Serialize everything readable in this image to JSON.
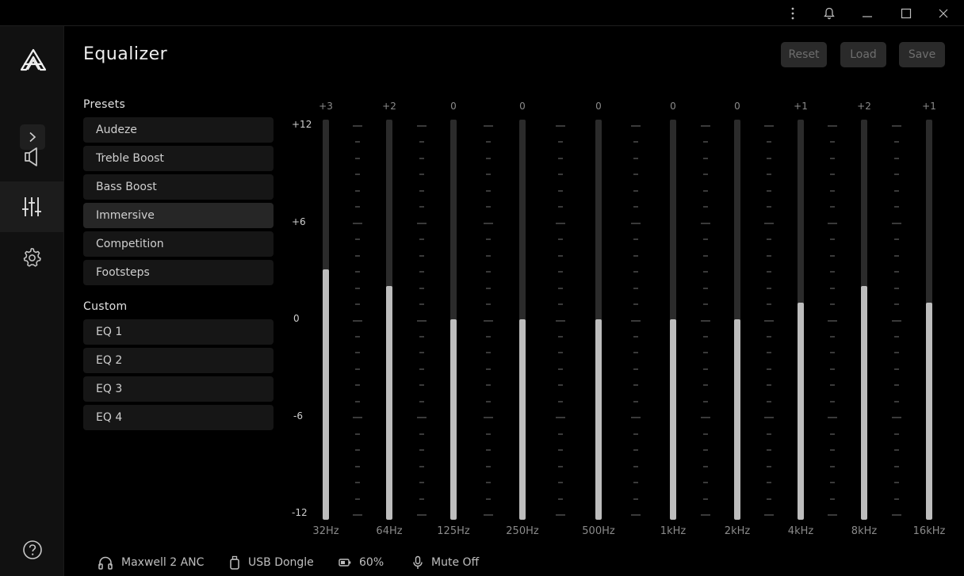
{
  "window": {
    "controls": [
      "more-icon",
      "bell-icon",
      "minimize-icon",
      "maximize-icon",
      "close-icon"
    ]
  },
  "sidebar": {
    "nav": [
      {
        "icon": "speaker-icon",
        "active": false
      },
      {
        "icon": "equalizer-icon",
        "active": true
      },
      {
        "icon": "gear-icon",
        "active": false
      }
    ],
    "help_icon": "help-icon"
  },
  "page": {
    "title": "Equalizer"
  },
  "toolbar": {
    "reset_label": "Reset",
    "load_label": "Load",
    "save_label": "Save"
  },
  "presets": {
    "label": "Presets",
    "items": [
      "Audeze",
      "Treble Boost",
      "Bass Boost",
      "Immersive",
      "Competition",
      "Footsteps"
    ],
    "selected": "Immersive"
  },
  "custom": {
    "label": "Custom",
    "items": [
      "EQ 1",
      "EQ 2",
      "EQ 3",
      "EQ 4"
    ]
  },
  "eq": {
    "scale_labels": [
      "+12",
      "+6",
      "0",
      "-6",
      "-12"
    ],
    "range": [
      -12,
      12
    ],
    "bands": [
      {
        "freq": "32Hz",
        "gain_label": "+3",
        "gain": 3
      },
      {
        "freq": "64Hz",
        "gain_label": "+2",
        "gain": 2
      },
      {
        "freq": "125Hz",
        "gain_label": "0",
        "gain": 0
      },
      {
        "freq": "250Hz",
        "gain_label": "0",
        "gain": 0
      },
      {
        "freq": "500Hz",
        "gain_label": "0",
        "gain": 0
      },
      {
        "freq": "1kHz",
        "gain_label": "0",
        "gain": 0
      },
      {
        "freq": "2kHz",
        "gain_label": "0",
        "gain": 0
      },
      {
        "freq": "4kHz",
        "gain_label": "+1",
        "gain": 1
      },
      {
        "freq": "8kHz",
        "gain_label": "+2",
        "gain": 2
      },
      {
        "freq": "16kHz",
        "gain_label": "+1",
        "gain": 1
      }
    ],
    "colors": {
      "fill": "#bdbdbd",
      "track": "#2b2b2b"
    }
  },
  "status": {
    "device": "Maxwell 2 ANC",
    "connection": "USB Dongle",
    "battery": "60%",
    "mic": "Mute Off"
  }
}
